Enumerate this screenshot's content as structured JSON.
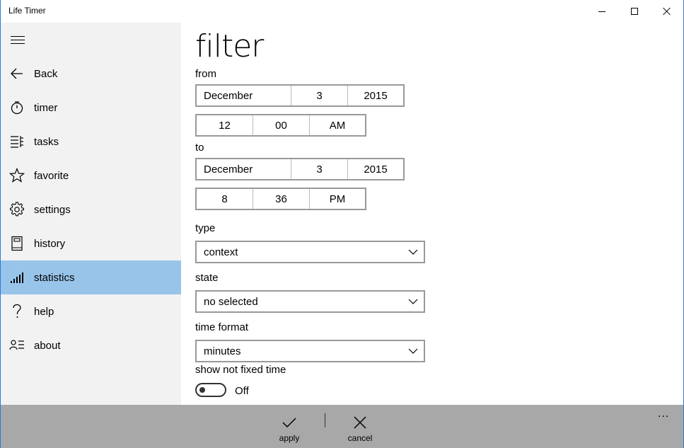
{
  "window": {
    "title": "Life Timer"
  },
  "sidebar": {
    "items": [
      {
        "label": "Back",
        "icon": "back-arrow-icon"
      },
      {
        "label": "timer",
        "icon": "stopwatch-icon"
      },
      {
        "label": "tasks",
        "icon": "list-icon"
      },
      {
        "label": "favorite",
        "icon": "star-icon"
      },
      {
        "label": "settings",
        "icon": "gear-icon"
      },
      {
        "label": "history",
        "icon": "book-icon"
      },
      {
        "label": "statistics",
        "icon": "signal-bars-icon",
        "active": true
      },
      {
        "label": "help",
        "icon": "question-icon"
      },
      {
        "label": "about",
        "icon": "contact-list-icon"
      }
    ],
    "active_color": "#98c4ea"
  },
  "filter": {
    "title": "filter",
    "from_label": "from",
    "from_date": {
      "month": "December",
      "day": "3",
      "year": "2015"
    },
    "from_time": {
      "hour": "12",
      "minute": "00",
      "period": "AM"
    },
    "to_label": "to",
    "to_date": {
      "month": "December",
      "day": "3",
      "year": "2015"
    },
    "to_time": {
      "hour": "8",
      "minute": "36",
      "period": "PM"
    },
    "type_label": "type",
    "type_value": "context",
    "state_label": "state",
    "state_value": "no selected",
    "time_format_label": "time format",
    "time_format_value": "minutes",
    "show_not_fixed_label": "show not fixed time",
    "show_not_fixed_state": "Off"
  },
  "commandbar": {
    "apply_label": "apply",
    "cancel_label": "cancel",
    "more": "...",
    "background": "#a8a8a8"
  }
}
